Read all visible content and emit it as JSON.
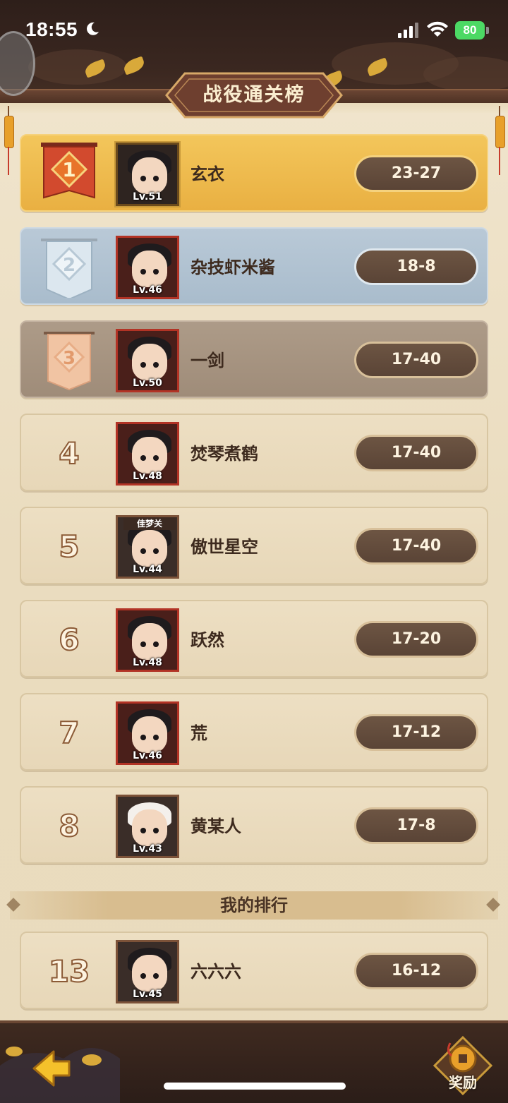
{
  "status_bar": {
    "time": "18:55",
    "battery": "80"
  },
  "title": "战役通关榜",
  "ranking": [
    {
      "rank": "1",
      "name": "玄衣",
      "level": "Lv.51",
      "score": "23-27",
      "style": "gold"
    },
    {
      "rank": "2",
      "name": "杂技虾米酱",
      "level": "Lv.46",
      "score": "18-8",
      "style": "silver"
    },
    {
      "rank": "3",
      "name": "一剑",
      "level": "Lv.50",
      "score": "17-40",
      "style": "bronze"
    },
    {
      "rank": "4",
      "name": "焚琴煮鹤",
      "level": "Lv.48",
      "score": "17-40",
      "style": "normal"
    },
    {
      "rank": "5",
      "name": "傲世星空",
      "level": "Lv.44",
      "score": "17-40",
      "style": "normal",
      "avatar_tag": "佳梦关"
    },
    {
      "rank": "6",
      "name": "跃然",
      "level": "Lv.48",
      "score": "17-20",
      "style": "normal"
    },
    {
      "rank": "7",
      "name": "荒",
      "level": "Lv.46",
      "score": "17-12",
      "style": "normal"
    },
    {
      "rank": "8",
      "name": "黄某人",
      "level": "Lv.43",
      "score": "17-8",
      "style": "normal"
    }
  ],
  "my_rank": {
    "label": "我的排行",
    "rank": "13",
    "name": "六六六",
    "level": "Lv.45",
    "score": "16-12"
  },
  "footer": {
    "reward_label": "奖励"
  },
  "colors": {
    "gold": "#e9b042",
    "silver": "#a9bccc",
    "bronze": "#9f8c79",
    "pill": "#5a4436"
  }
}
